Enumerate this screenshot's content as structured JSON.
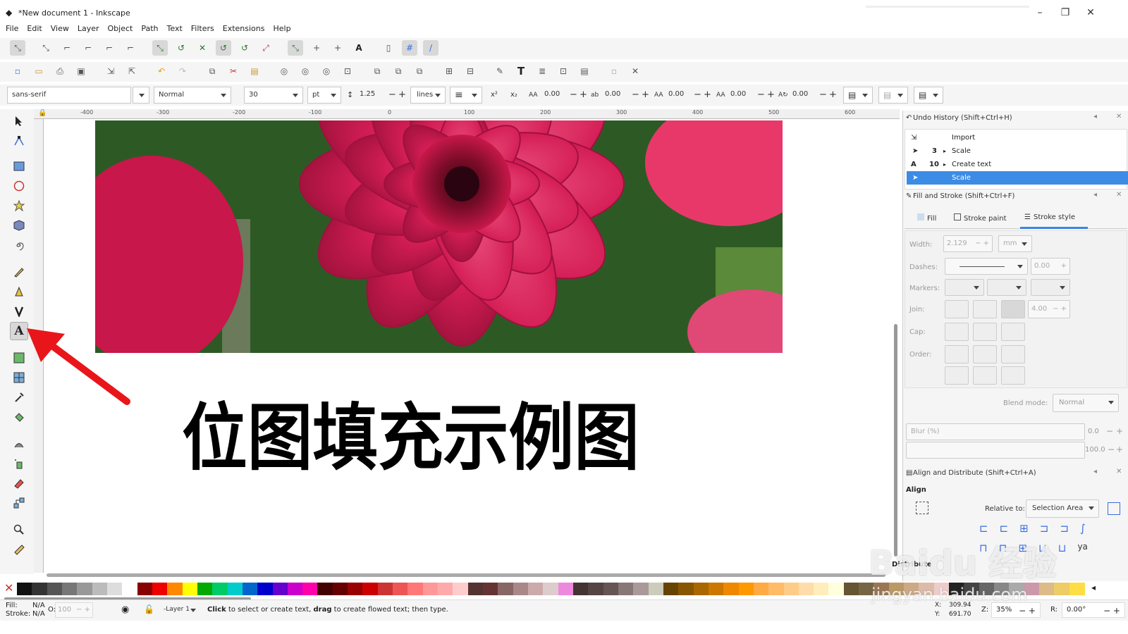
{
  "window": {
    "title": "*New document 1 - Inkscape",
    "minimize": "–",
    "restore": "❐",
    "close": "✕"
  },
  "menu": [
    "File",
    "Edit",
    "View",
    "Layer",
    "Object",
    "Path",
    "Text",
    "Filters",
    "Extensions",
    "Help"
  ],
  "text_toolbar": {
    "font_family": "sans-serif",
    "font_style": "Normal",
    "font_size": "30",
    "unit": "pt",
    "line_spacing": "1.25",
    "spacing_mode": "lines",
    "letter_spacing": "0.00",
    "word_spacing": "0.00",
    "kerning_h": "0.00",
    "kerning_v": "0.00",
    "rotation": "0.00"
  },
  "ruler_ticks": [
    "-400",
    "-300",
    "-200",
    "-100",
    "0",
    "100",
    "200",
    "300",
    "400",
    "500",
    "600"
  ],
  "canvas": {
    "text": "位图填充示例图"
  },
  "undo_history": {
    "title": "Undo History (Shift+Ctrl+H)",
    "items": [
      {
        "count": "",
        "label": "Import",
        "selected": false
      },
      {
        "count": "3",
        "label": "Scale",
        "selected": false
      },
      {
        "count": "10",
        "label": "Create text",
        "selected": false
      },
      {
        "count": "",
        "label": "Scale",
        "selected": true
      }
    ]
  },
  "fill_stroke": {
    "title": "Fill and Stroke (Shift+Ctrl+F)",
    "tabs": [
      "Fill",
      "Stroke paint",
      "Stroke style"
    ],
    "width_label": "Width:",
    "width_value": "2.129",
    "width_unit": "mm",
    "dashes_label": "Dashes:",
    "dashes_value": "0.00",
    "markers_label": "Markers:",
    "join_label": "Join:",
    "join_value": "4.00",
    "cap_label": "Cap:",
    "order_label": "Order:",
    "blend_label": "Blend mode:",
    "blend_value": "Normal",
    "blur_label": "Blur (%)",
    "blur_value": "0.0",
    "opacity_value": "100.0"
  },
  "align": {
    "title": "Align and Distribute (Shift+Ctrl+A)",
    "section": "Align",
    "relative_label": "Relative to:",
    "relative_value": "Selection Area",
    "distribute": "Distribute"
  },
  "status": {
    "fill_label": "Fill:",
    "fill_value": "N/A",
    "stroke_label": "Stroke:",
    "stroke_value": "N/A",
    "opacity_label": "O:",
    "opacity_value": "100",
    "layer": "-Layer 1",
    "msg_b1": "Click",
    "msg_t1": " to select or create text, ",
    "msg_b2": "drag",
    "msg_t2": " to create flowed text; then type.",
    "x_label": "X:",
    "x_value": "309.94",
    "y_label": "Y:",
    "y_value": "691.70",
    "zoom_label": "Z:",
    "zoom_value": "35%",
    "rot_label": "R:",
    "rot_value": "0.00°"
  },
  "watermark": {
    "line1": "Baidu 经验",
    "line2": "jingyan.baidu.com"
  },
  "colors": {
    "accent": "#3a86e0",
    "arrow": "#e8161b",
    "selected_row": "#3c8ce6"
  }
}
